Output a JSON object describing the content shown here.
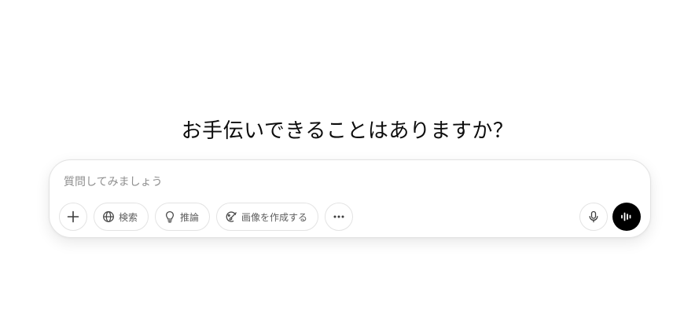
{
  "heading": "お手伝いできることはありますか？",
  "composer": {
    "placeholder": "質問してみましょう",
    "value": ""
  },
  "toolbar": {
    "add": {
      "icon": "plus-icon"
    },
    "tools": [
      {
        "label": "検索",
        "icon": "globe-icon"
      },
      {
        "label": "推論",
        "icon": "lightbulb-icon"
      },
      {
        "label": "画像を作成する",
        "icon": "image-brush-icon"
      }
    ],
    "more": {
      "icon": "ellipsis-icon"
    },
    "dictate": {
      "icon": "microphone-icon"
    },
    "voice": {
      "icon": "waveform-icon"
    }
  },
  "colors": {
    "background": "#ffffff",
    "text": "#0d0d0d",
    "placeholder": "#8f8f8f",
    "pill_text": "#5d5d5d",
    "border": "#e3e3e3",
    "voice_button": "#000000"
  }
}
